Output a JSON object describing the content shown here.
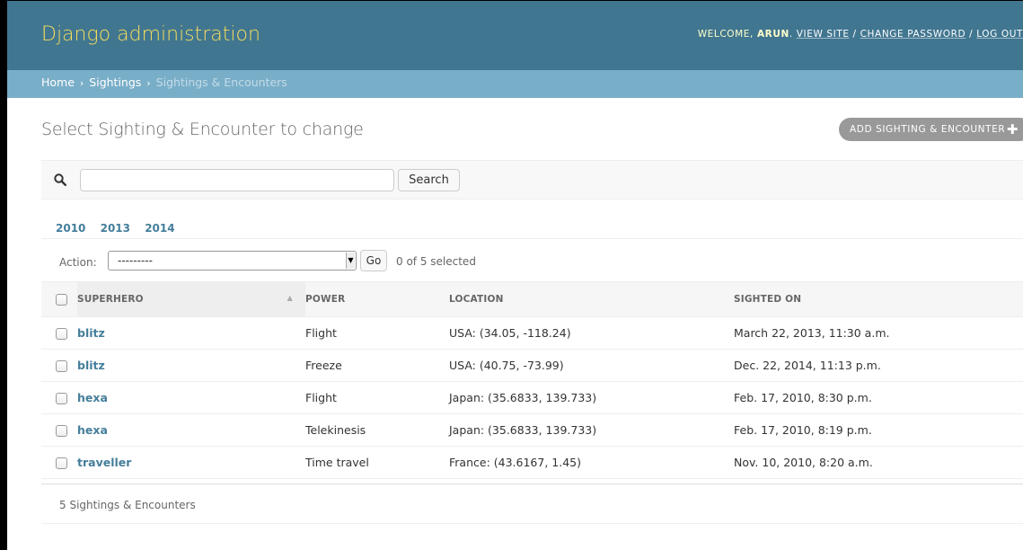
{
  "header": {
    "branding": "Django administration",
    "welcome_prefix": "WELCOME,",
    "username": "ARUN",
    "links": [
      "VIEW SITE",
      "CHANGE PASSWORD",
      "LOG OUT"
    ]
  },
  "breadcrumbs": {
    "home": "Home",
    "app": "Sightings",
    "current": "Sightings & Encounters",
    "separator": "›"
  },
  "page": {
    "title": "Select Sighting & Encounter to change",
    "add_button": "ADD SIGHTING & ENCOUNTER",
    "add_icon": "plus-icon"
  },
  "search": {
    "value": "",
    "button": "Search",
    "icon": "search-icon"
  },
  "date_hierarchy": [
    "2010",
    "2013",
    "2014"
  ],
  "actions": {
    "label": "Action:",
    "selected_option": "---------",
    "go_button": "Go",
    "selection_count": "0 of 5 selected"
  },
  "table": {
    "columns": [
      "SUPERHERO",
      "POWER",
      "LOCATION",
      "SIGHTED ON"
    ],
    "sorted_column": "SUPERHERO",
    "rows": [
      {
        "superhero": "blitz",
        "power": "Flight",
        "location": "USA: (34.05, -118.24)",
        "sighted_on": "March 22, 2013, 11:30 a.m."
      },
      {
        "superhero": "blitz",
        "power": "Freeze",
        "location": "USA: (40.75, -73.99)",
        "sighted_on": "Dec. 22, 2014, 11:13 p.m."
      },
      {
        "superhero": "hexa",
        "power": "Flight",
        "location": "Japan: (35.6833, 139.733)",
        "sighted_on": "Feb. 17, 2010, 8:30 p.m."
      },
      {
        "superhero": "hexa",
        "power": "Telekinesis",
        "location": "Japan: (35.6833, 139.733)",
        "sighted_on": "Feb. 17, 2010, 8:19 p.m."
      },
      {
        "superhero": "traveller",
        "power": "Time travel",
        "location": "France: (43.6167, 1.45)",
        "sighted_on": "Nov. 10, 2010, 8:20 a.m."
      }
    ]
  },
  "paginator": {
    "text": "5 Sightings & Encounters"
  },
  "colors": {
    "header_bg": "#417690",
    "branding": "#f5dd5d",
    "breadcrumbs_bg": "#79aec8",
    "link": "#447e9b",
    "add_button_bg": "#999999"
  }
}
